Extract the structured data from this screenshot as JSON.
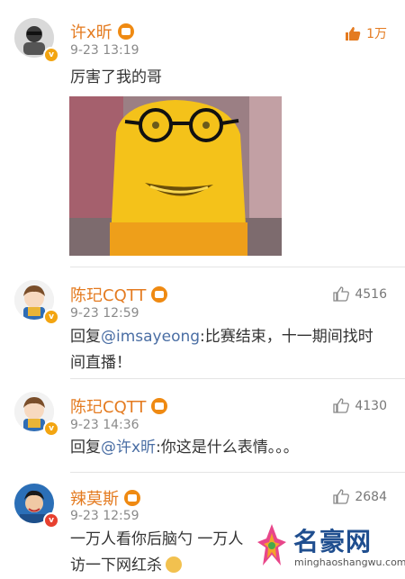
{
  "comments": [
    {
      "name": "许x昕",
      "time": "9-23 13:19",
      "text": "厉害了我的哥",
      "likes": "1万",
      "liked": true
    },
    {
      "name": "陈玘CQTT",
      "time": "9-23 12:59",
      "reply_prefix": "回复",
      "mention": "@imsayeong",
      "text": ":比赛结束，十一期间找时间直播！",
      "likes": "4516"
    },
    {
      "name": "陈玘CQTT",
      "time": "9-23 14:36",
      "reply_prefix": "回复",
      "mention": "@许x昕",
      "text": ":你这是什么表情。。。",
      "likes": "4130"
    },
    {
      "name": "辣莫斯",
      "time": "9-23 12:59",
      "text_line1": "一万人看你后脑勺 一万人",
      "text_line2": "访一下网红杀",
      "likes": "2684"
    }
  ],
  "watermark": {
    "brand": "名豪网",
    "url": "minghaoshangwu.com"
  },
  "colors": {
    "name": "#e47b20",
    "mention": "#4a6ea4",
    "time": "#8a8a8a",
    "watermark": "#1f4e8f"
  }
}
